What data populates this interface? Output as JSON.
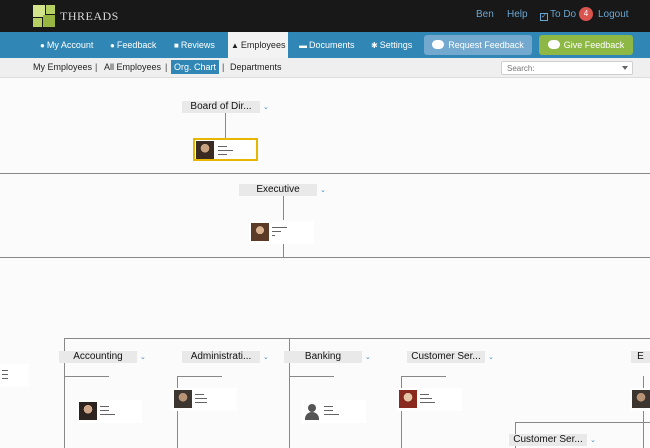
{
  "app": {
    "brand": "THREADS"
  },
  "topbar": {
    "user": "Ben",
    "help": "Help",
    "todo": "To Do",
    "todo_count": "4",
    "logout": "Logout"
  },
  "nav": {
    "my_account": "My Account",
    "feedback": "Feedback",
    "reviews": "Reviews",
    "employees": "Employees",
    "documents": "Documents",
    "settings": "Settings",
    "request_feedback": "Request Feedback",
    "give_feedback": "Give Feedback"
  },
  "subnav": {
    "my_employees": "My Employees",
    "all_employees": "All Employees",
    "org_chart": "Org. Chart",
    "departments": "Departments",
    "separator": "|",
    "search_placeholder": "Search:"
  },
  "org_chart": {
    "chevron": "⌄",
    "departments": {
      "board": "Board of Dir...",
      "executive": "Executive",
      "accounting": "Accounting",
      "administration": "Administrati...",
      "banking": "Banking",
      "customer_service": "Customer Ser...",
      "customer_service_2": "Customer Ser...",
      "edge": "E"
    }
  },
  "colors": {
    "topbar": "#181818",
    "navbar": "#3087b5",
    "accent_blue": "#3087b5",
    "give_green": "#8db845",
    "request_blue": "#73a9cf",
    "badge_red": "#d9534f",
    "highlight": "#e6b600"
  }
}
